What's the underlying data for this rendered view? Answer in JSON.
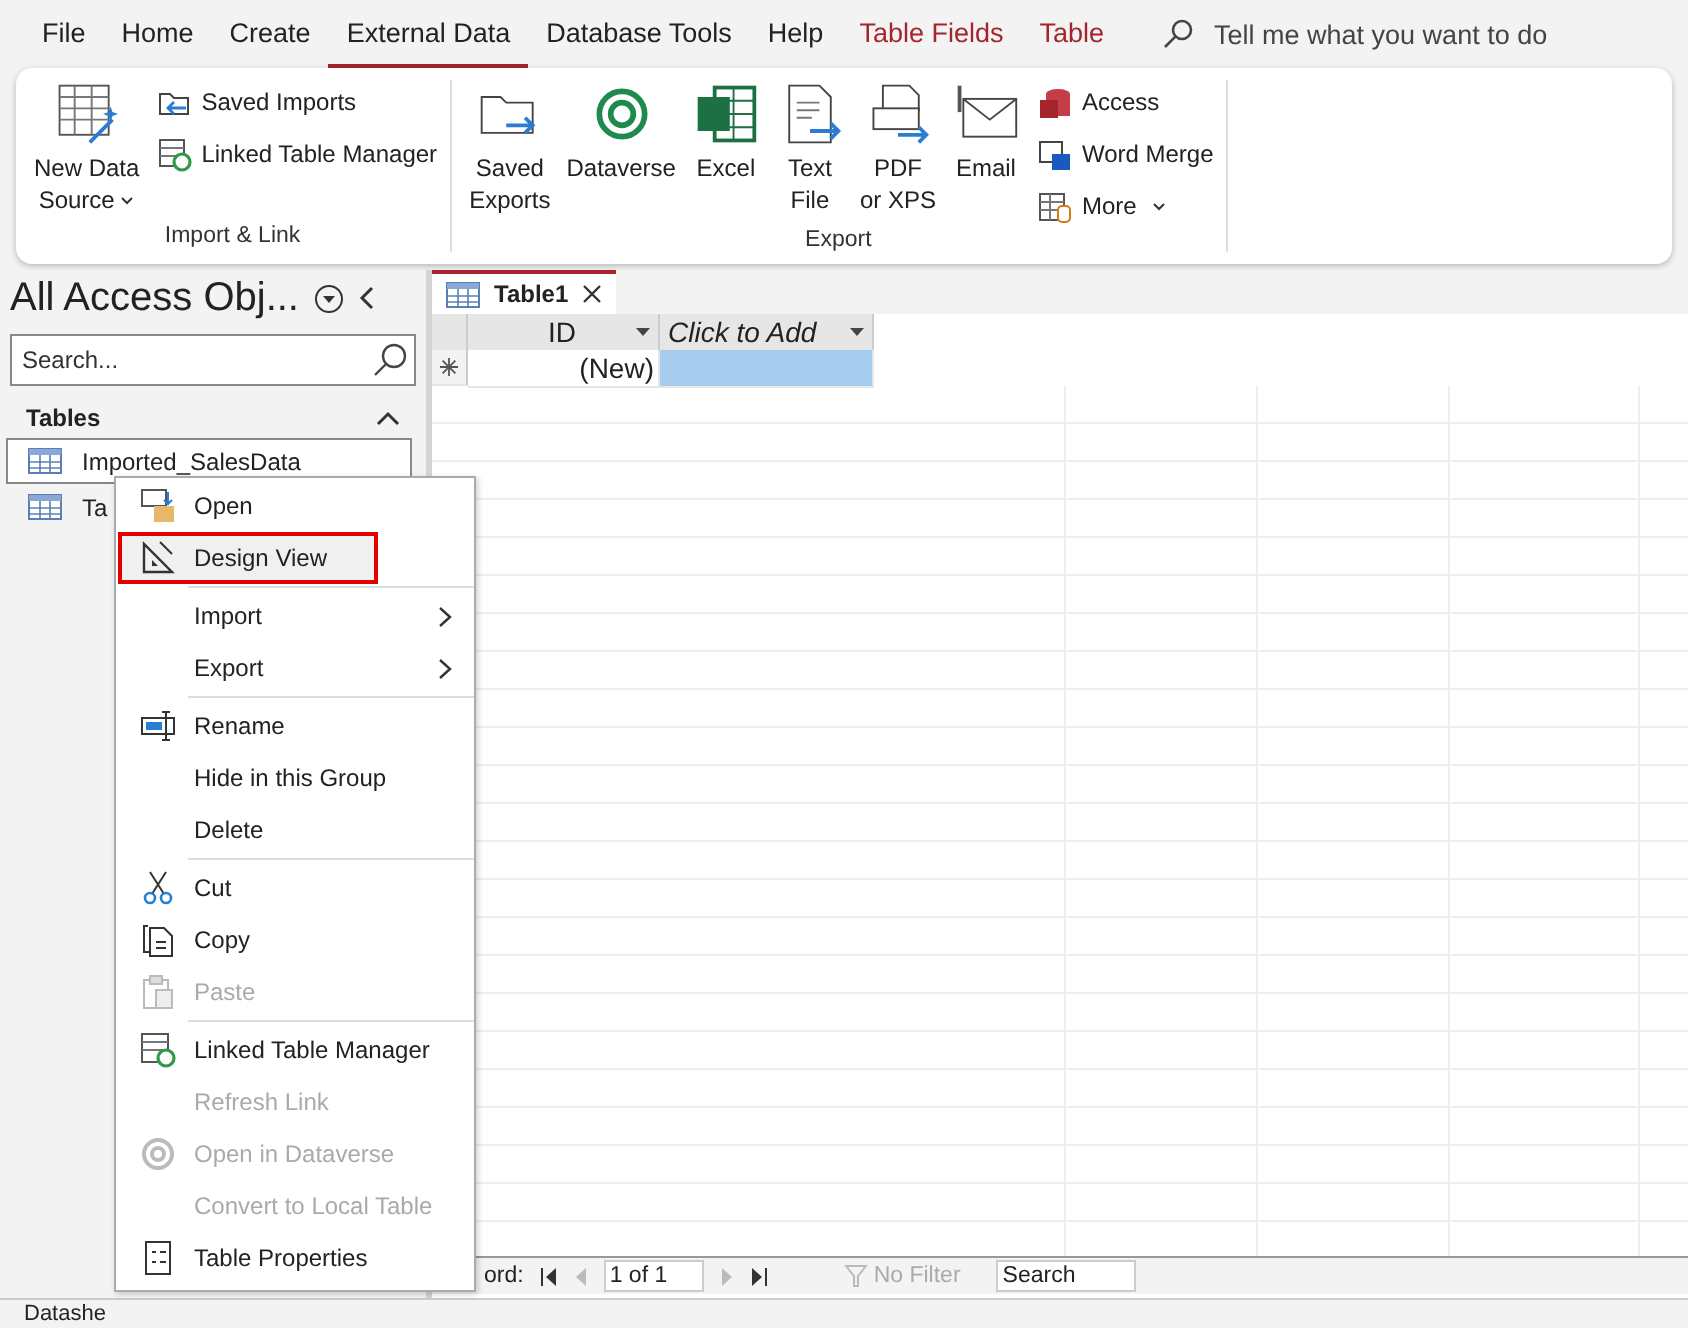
{
  "ribbon_tabs": [
    {
      "label": "File",
      "selected": false,
      "kind": "normal"
    },
    {
      "label": "Home",
      "selected": false,
      "kind": "normal"
    },
    {
      "label": "Create",
      "selected": false,
      "kind": "normal"
    },
    {
      "label": "External Data",
      "selected": true,
      "kind": "normal"
    },
    {
      "label": "Database Tools",
      "selected": false,
      "kind": "normal"
    },
    {
      "label": "Help",
      "selected": false,
      "kind": "normal"
    },
    {
      "label": "Table Fields",
      "selected": false,
      "kind": "contextual"
    },
    {
      "label": "Table",
      "selected": false,
      "kind": "contextual"
    }
  ],
  "tell_me": {
    "placeholder": "Tell me what you want to do"
  },
  "ribbon_groups": [
    {
      "label": "Import & Link",
      "large": [
        {
          "lines": [
            "New Data",
            "Source"
          ],
          "kind": "new-source",
          "dropdown": true
        }
      ],
      "small": [
        {
          "label": "Saved Imports",
          "kind": "saved-imports",
          "dropdown": false
        },
        {
          "label": "Linked Table Manager",
          "kind": "linked",
          "dropdown": false
        }
      ]
    },
    {
      "label": "Export",
      "large": [
        {
          "lines": [
            "Saved",
            "Exports"
          ],
          "kind": "saved-exports",
          "dropdown": false
        },
        {
          "lines": [
            "Dataverse"
          ],
          "kind": "dataverse",
          "dropdown": false
        },
        {
          "lines": [
            "Excel"
          ],
          "kind": "excel",
          "dropdown": false
        },
        {
          "lines": [
            "Text",
            "File"
          ],
          "kind": "text-file",
          "dropdown": false
        },
        {
          "lines": [
            "PDF",
            "or XPS"
          ],
          "kind": "pdf",
          "dropdown": false
        },
        {
          "lines": [
            "Email"
          ],
          "kind": "email",
          "dropdown": false
        }
      ],
      "small": [
        {
          "label": "Access",
          "kind": "access",
          "dropdown": false
        },
        {
          "label": "Word Merge",
          "kind": "word",
          "dropdown": false
        },
        {
          "label": "More",
          "kind": "more",
          "dropdown": true
        }
      ]
    }
  ],
  "nav_pane": {
    "title": "All Access Obj...",
    "search": {
      "placeholder": "Search..."
    },
    "section": "Tables",
    "items": [
      {
        "label": "Imported_SalesData",
        "selected": true
      },
      {
        "label": "Ta",
        "selected": false
      }
    ]
  },
  "document_tab": {
    "label": "Table1"
  },
  "datasheet": {
    "columns": [
      {
        "label": "ID",
        "kind": "field"
      },
      {
        "label": "Click to Add",
        "kind": "add"
      }
    ],
    "new_row": {
      "cells": [
        {
          "text": "(New)",
          "selected": false
        },
        {
          "text": "",
          "selected": true
        }
      ]
    }
  },
  "record_nav": {
    "label": "ord:",
    "position": "1 of 1",
    "filter": "No Filter",
    "search": "Search"
  },
  "status_bar": {
    "text": "Datashe"
  },
  "context_menu": [
    {
      "label": "Open",
      "kind": "open",
      "disabled": false,
      "selected": false,
      "submenu": false
    },
    {
      "label": "Design View",
      "kind": "design",
      "disabled": false,
      "selected": true,
      "submenu": false
    },
    {
      "kind": "separator"
    },
    {
      "label": "Import",
      "kind": "none",
      "disabled": false,
      "selected": false,
      "submenu": true
    },
    {
      "label": "Export",
      "kind": "none",
      "disabled": false,
      "selected": false,
      "submenu": true
    },
    {
      "kind": "separator"
    },
    {
      "label": "Rename",
      "kind": "rename",
      "disabled": false,
      "selected": false,
      "submenu": false
    },
    {
      "label": "Hide in this Group",
      "kind": "none",
      "disabled": false,
      "selected": false,
      "submenu": false
    },
    {
      "label": "Delete",
      "kind": "none",
      "disabled": false,
      "selected": false,
      "submenu": false
    },
    {
      "kind": "separator"
    },
    {
      "label": "Cut",
      "kind": "cut",
      "disabled": false,
      "selected": false,
      "submenu": false
    },
    {
      "label": "Copy",
      "kind": "copy",
      "disabled": false,
      "selected": false,
      "submenu": false
    },
    {
      "label": "Paste",
      "kind": "paste",
      "disabled": true,
      "selected": false,
      "submenu": false
    },
    {
      "kind": "separator"
    },
    {
      "label": "Linked Table Manager",
      "kind": "linked",
      "disabled": false,
      "selected": false,
      "submenu": false
    },
    {
      "label": "Refresh Link",
      "kind": "none",
      "disabled": true,
      "selected": false,
      "submenu": false
    },
    {
      "label": "Open in Dataverse",
      "kind": "dataverse",
      "disabled": true,
      "selected": false,
      "submenu": false
    },
    {
      "label": "Convert to Local Table",
      "kind": "none",
      "disabled": true,
      "selected": false,
      "submenu": false
    },
    {
      "label": "Table Properties",
      "kind": "properties",
      "disabled": false,
      "selected": false,
      "submenu": false
    }
  ]
}
